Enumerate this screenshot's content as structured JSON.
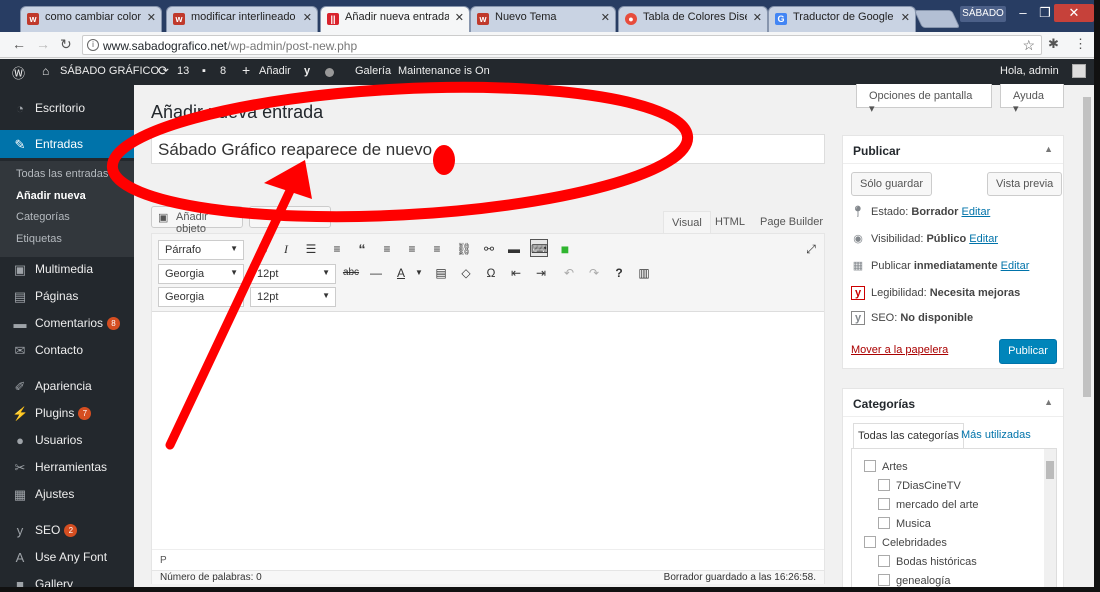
{
  "browser": {
    "tabs": [
      {
        "title": "como cambiar color títu",
        "favicon": "w",
        "favcolor": "#c0392b"
      },
      {
        "title": "modificar interlineado d",
        "favicon": "w",
        "favcolor": "#c0392b"
      },
      {
        "title": "Añadir nueva entrada ‹",
        "favicon": "||",
        "favcolor": "#d9232d"
      },
      {
        "title": "Nuevo Tema",
        "favicon": "w",
        "favcolor": "#c0392b"
      },
      {
        "title": "Tabla de Colores Diseñ",
        "favicon": "●",
        "favcolor": "#e74c3c"
      },
      {
        "title": "Traductor de Google",
        "favicon": "G",
        "favcolor": "#4285f4"
      }
    ],
    "profile": "SÁBADO",
    "url_host": "www.sabadografico.net",
    "url_path": "/wp-admin/post-new.php"
  },
  "adminbar": {
    "site": "SÁBADO GRÁFICO",
    "updates": "13",
    "comments": "8",
    "new": "Añadir",
    "gallery": "Galería",
    "maintenance": "Maintenance is On",
    "greeting": "Hola, admin"
  },
  "sidebar": {
    "items": [
      {
        "label": "Escritorio",
        "icon": "dashboard-icon"
      },
      {
        "label": "Entradas",
        "icon": "pin-icon"
      },
      {
        "label": "Multimedia",
        "icon": "media-icon"
      },
      {
        "label": "Páginas",
        "icon": "pages-icon"
      },
      {
        "label": "Comentarios",
        "icon": "comments-icon",
        "badge": "8"
      },
      {
        "label": "Contacto",
        "icon": "mail-icon"
      },
      {
        "label": "Apariencia",
        "icon": "appearance-icon"
      },
      {
        "label": "Plugins",
        "icon": "plugins-icon",
        "badge": "7"
      },
      {
        "label": "Usuarios",
        "icon": "users-icon"
      },
      {
        "label": "Herramientas",
        "icon": "tools-icon"
      },
      {
        "label": "Ajustes",
        "icon": "settings-icon"
      },
      {
        "label": "SEO",
        "icon": "seo-icon",
        "badge": "2"
      },
      {
        "label": "Use Any Font",
        "icon": "font-icon"
      },
      {
        "label": "Gallery",
        "icon": "gallery-icon"
      }
    ],
    "submenu": [
      "Todas las entradas",
      "Añadir nueva",
      "Categorías",
      "Etiquetas"
    ]
  },
  "main": {
    "title": "Añadir nueva entrada",
    "screen_options": "Opciones de pantalla",
    "help": "Ayuda",
    "post_title": "Sábado Gráfico reaparece de nuevo",
    "add_media": "Añadir objeto",
    "editor_tabs": [
      "Visual",
      "HTML",
      "Page Builder"
    ],
    "format_select": "Párrafo",
    "font_select": "Georgia",
    "size_select": "12pt",
    "font_select2": "Georgia",
    "size_select2": "12pt",
    "path": "P",
    "word_count": "Número de palabras: 0",
    "saved": "Borrador guardado a las 16:26:58."
  },
  "publish": {
    "title": "Publicar",
    "save_draft": "Sólo guardar",
    "preview": "Vista previa",
    "status_label": "Estado:",
    "status_value": "Borrador",
    "visibility_label": "Visibilidad:",
    "visibility_value": "Público",
    "schedule_label": "Publicar",
    "schedule_value": "inmediatamente",
    "readability_label": "Legibilidad:",
    "readability_value": "Necesita mejoras",
    "seo_label": "SEO:",
    "seo_value": "No disponible",
    "edit": "Editar",
    "trash": "Mover a la papelera",
    "publish_btn": "Publicar"
  },
  "categories": {
    "title": "Categorías",
    "tab_all": "Todas las categorías",
    "tab_popular": "Más utilizadas",
    "items": [
      {
        "label": "Artes",
        "level": 0
      },
      {
        "label": "7DiasCineTV",
        "level": 1
      },
      {
        "label": "mercado del arte",
        "level": 1
      },
      {
        "label": "Musica",
        "level": 1
      },
      {
        "label": "Celebridades",
        "level": 0
      },
      {
        "label": "Bodas históricas",
        "level": 1
      },
      {
        "label": "genealogía",
        "level": 1
      }
    ]
  },
  "colors": {
    "accent": "#0073aa",
    "annotation": "#ff0000",
    "admin_dark": "#23282d"
  }
}
